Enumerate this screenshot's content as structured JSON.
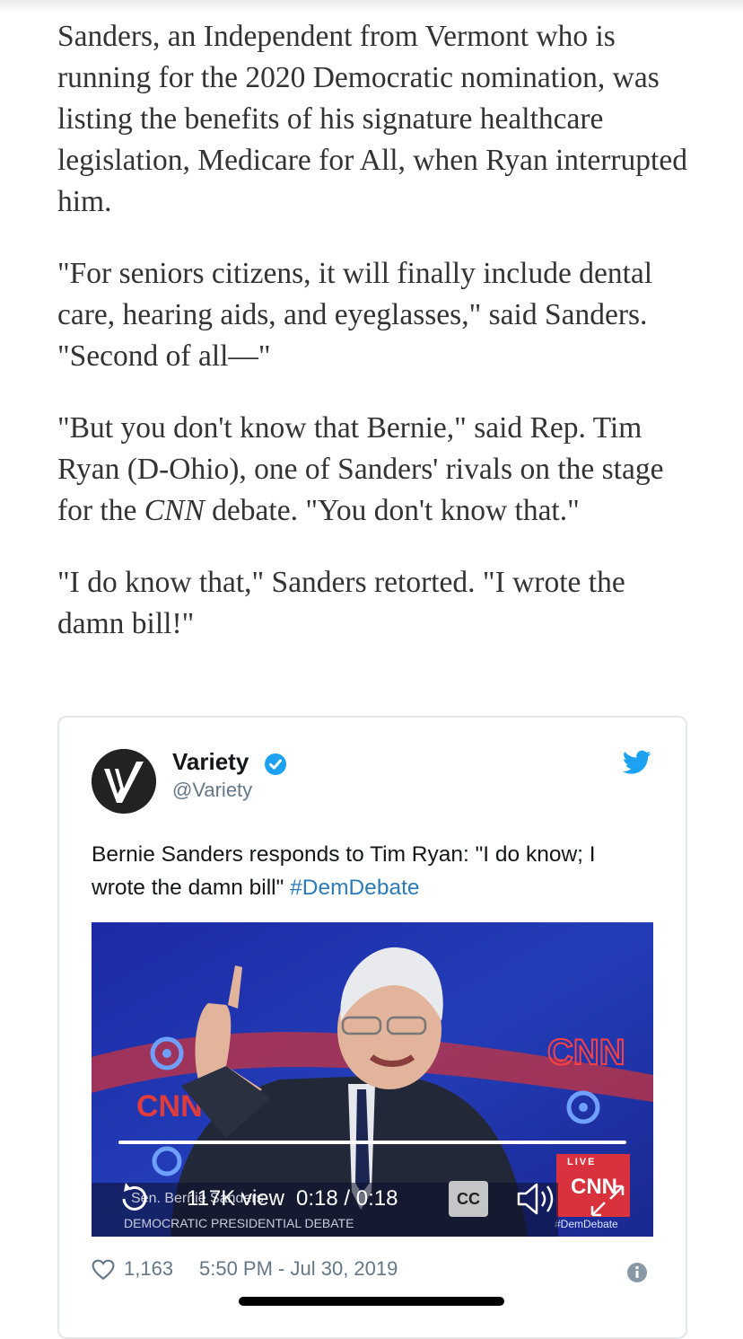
{
  "article": {
    "paragraphs": [
      "Sanders, an Independent from Vermont who is running for the 2020 Democratic nomination, was listing the benefits of his signature healthcare legislation, Medicare for All, when Ryan interrupted him.",
      "\"For seniors citizens, it will finally include dental care, hearing aids, and eyeglasses,\" said Sanders. \"Second of all—\""
    ],
    "p3_before": "\"But you don't know that Bernie,\" said Rep. Tim Ryan (D-Ohio), one of Sanders' rivals on the stage for the ",
    "p3_italic": "CNN",
    "p3_after": " debate. \"You don't know that.\"",
    "p4": "\"I do know that,\" Sanders retorted. \"I wrote the damn bill!\""
  },
  "tweet": {
    "author_name": "Variety",
    "handle": "@Variety",
    "text": "Bernie Sanders responds to Tim Ryan: \"I do know; I wrote the damn bill\" ",
    "hashtag": "#DemDebate",
    "video": {
      "progress": 1.0,
      "views": "117K view",
      "time": "0:18 / 0:18",
      "cc_label": "CC",
      "broadcast_logo": "CNN",
      "live_label": "LIVE",
      "lower_third": "DEMOCRATIC PRESIDENTIAL DEBATE",
      "lower_third_name": "Sen. Bernie Sanders",
      "hashtag_bug": "#DemDebate"
    },
    "likes": "1,163",
    "timestamp": "5:50 PM - Jul 30, 2019"
  },
  "colors": {
    "article_text": "#333333",
    "link": "#2b7bb9",
    "twitter_blue": "#1da1f2",
    "video_bg": "#1e2f9e"
  },
  "icons": [
    "twitter-bird-icon",
    "verified-badge-icon",
    "replay-icon",
    "cc-icon",
    "volume-icon",
    "fullscreen-icon",
    "heart-icon",
    "info-icon"
  ]
}
